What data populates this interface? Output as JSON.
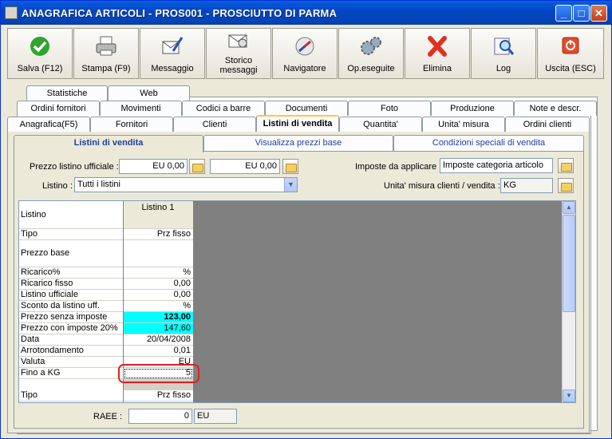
{
  "window": {
    "title": "ANAGRAFICA ARTICOLI - PROS001 - PROSCIUTTO DI PARMA"
  },
  "toolbar": {
    "buttons": [
      {
        "label": "Salva (F12)",
        "icon": "check-icon"
      },
      {
        "label": "Stampa (F9)",
        "icon": "printer-icon"
      },
      {
        "label": "Messaggio",
        "icon": "message-icon"
      },
      {
        "label": "Storico messaggi",
        "icon": "message-history-icon"
      },
      {
        "label": "Navigatore",
        "icon": "compass-icon"
      },
      {
        "label": "Op.eseguite",
        "icon": "gears-icon"
      },
      {
        "label": "Elimina",
        "icon": "delete-x-icon"
      },
      {
        "label": "Log",
        "icon": "log-magnifier-icon"
      },
      {
        "label": "Uscita (ESC)",
        "icon": "exit-icon"
      }
    ]
  },
  "tabs": {
    "row1": [
      "Statistiche",
      "Web"
    ],
    "row2": [
      "Ordini fornitori",
      "Movimenti",
      "Codici a barre",
      "Documenti",
      "Foto",
      "Produzione",
      "Note e descr."
    ],
    "row3": [
      "Anagrafica(F5)",
      "Fornitori",
      "Clienti",
      "Listini di vendita",
      "Quantita'",
      "Unita' misura",
      "Ordini clienti"
    ],
    "active": "Listini di vendita"
  },
  "subtabs": {
    "items": [
      "Listini di vendita",
      "Visualizza prezzi base",
      "Condizioni speciali di vendita"
    ],
    "active": "Listini di vendita"
  },
  "form": {
    "prezzo_listino_label": "Prezzo listino ufficiale :",
    "prezzo_listino_1": "EU 0,00",
    "prezzo_listino_2": "EU 0,00",
    "imposte_label": "Imposte da applicare :",
    "imposte_value": "Imposte categoria articolo",
    "listino_label": "Listino :",
    "listino_value": "Tutti i listini",
    "unita_label": "Unita' misura clienti / vendita :",
    "unita_value": "KG"
  },
  "grid": {
    "header_label": "Listino",
    "column_title": "Listino 1",
    "rows": [
      {
        "label": "Tipo",
        "value": "Prz fisso"
      },
      {
        "label": "Prezzo base",
        "value": ""
      },
      {
        "label": "Ricarico%",
        "value": "%"
      },
      {
        "label": "Ricarico fisso",
        "value": "0,00"
      },
      {
        "label": "Listino ufficiale",
        "value": "0,00"
      },
      {
        "label": "Sconto da listino uff.",
        "value": "%"
      },
      {
        "label": "Prezzo senza imposte",
        "value": "123,00"
      },
      {
        "label": "Prezzo con imposte 20%",
        "value": "147,60"
      },
      {
        "label": "Data",
        "value": "20/04/2008"
      },
      {
        "label": "Arrotondamento",
        "value": "0,01"
      },
      {
        "label": "Valuta",
        "value": "EU"
      },
      {
        "label": "Fino a KG",
        "value": "5"
      },
      {
        "label": "Tipo",
        "value": "Prz fisso"
      }
    ]
  },
  "raee": {
    "label": "RAEE :",
    "value": "0",
    "currency": "EU"
  },
  "colors": {
    "highlight_cyan": "#00ffff",
    "annotation_red": "#e21f1f",
    "titlebar_blue": "#0347c6"
  }
}
